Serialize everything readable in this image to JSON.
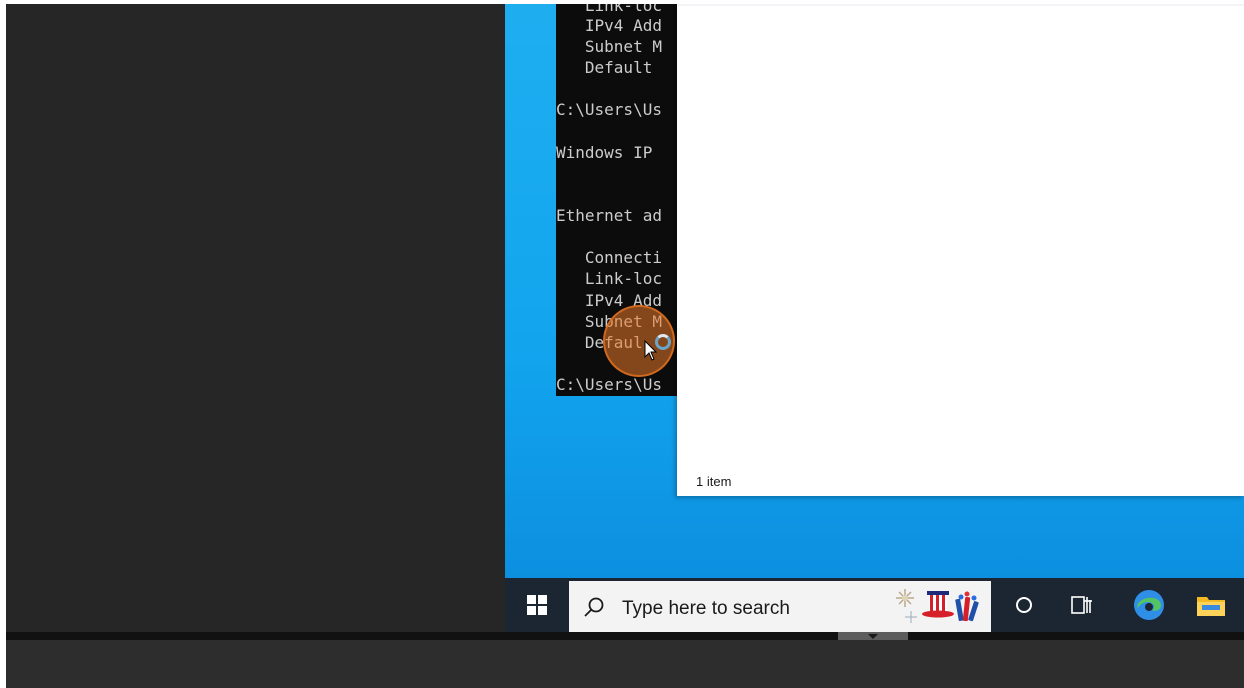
{
  "cmd": {
    "lines": [
      "   Link-loc",
      "   IPv4 Add",
      "   Subnet M",
      "   Default ",
      "",
      "C:\\Users\\Us",
      "",
      "Windows IP ",
      "",
      "",
      "Ethernet ad",
      "",
      "   Connecti",
      "   Link-loc",
      "   IPv4 Add",
      "   Subnet M",
      "   Defaul",
      "",
      "C:\\Users\\Us"
    ]
  },
  "explorer": {
    "status": "1 item"
  },
  "taskbar": {
    "search_placeholder": "Type here to search",
    "start_icon": "windows-logo-icon",
    "cortana_icon": "cortana-circle-icon",
    "task_view_icon": "task-view-icon",
    "edge_icon": "edge-browser-icon",
    "explorer_icon": "file-explorer-icon"
  },
  "colors": {
    "desktop": "#12a5ee",
    "taskbar": "#1c2633",
    "click_indicator": "#e87828"
  }
}
